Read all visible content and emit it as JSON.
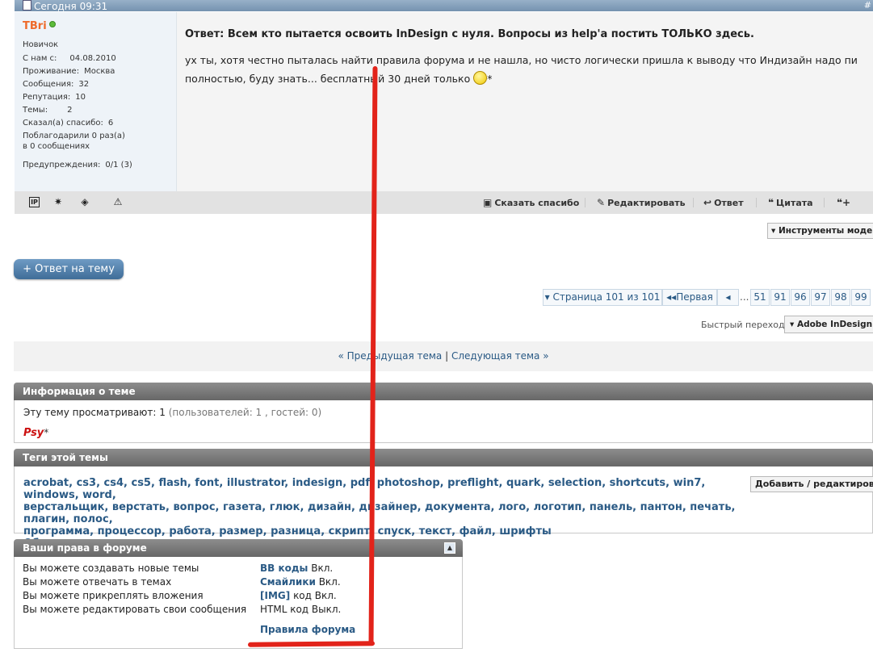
{
  "post": {
    "date": "Сегодня 09:31",
    "corner_mark": "#",
    "user": {
      "name": "TBri",
      "rank": "Новичок",
      "fields": [
        {
          "label": "С нам с:",
          "value": "04.08.2010"
        },
        {
          "label": "Проживание:",
          "value": "Москва"
        },
        {
          "label": "Сообщения:",
          "value": "32"
        },
        {
          "label": "Репутация:",
          "value": "10"
        },
        {
          "label": "Темы:",
          "value": "2"
        },
        {
          "label": "Сказал(а) спасибо:",
          "value": "6"
        }
      ],
      "thanked_line1": "Поблагодарили 0 раз(а)",
      "thanked_line2": "в 0 сообщениях",
      "warnings_label": "Предупреждения:",
      "warnings_value": "0/1 (3)"
    },
    "title": "Ответ: Всем кто пытается освоить InDesign с нуля. Вопросы из help'а постить ТОЛЬКО здесь.",
    "text_line1": "ух ты, хотя честно пыталась найти правила форума и не нашла, но чисто логически пришла к выводу что Индизайн надо пи",
    "text_line2": "полностью, буду знать... бесплатный 30 дней только",
    "text_suffix": "*",
    "actions": {
      "thanks": "Сказать спасибо",
      "edit": "Редактировать",
      "reply": "Ответ",
      "quote": "Цитата"
    }
  },
  "mod_tools": "Инструменты модер",
  "reply_button": "+ Ответ на тему",
  "pager": {
    "label": "Страница 101 из 101",
    "first": "Первая",
    "ellipsis": "...",
    "pages": [
      "51",
      "91",
      "96",
      "97",
      "98",
      "99"
    ]
  },
  "quick_nav": {
    "label": "Быстрый переход",
    "value": "Adobe InDesign"
  },
  "navlinks": {
    "prev": "« Предыдущая тема",
    "sep": "|",
    "next": "Следующая тема »"
  },
  "topic_info": {
    "title": "Информация о теме",
    "viewing_prefix": "Эту тему просматривают:",
    "viewing_count": "1",
    "viewing_detail": "(пользователей: 1 , гостей: 0)",
    "viewer": "Psy",
    "viewer_suffix": "*"
  },
  "tags": {
    "title": "Теги этой темы",
    "line1": "acrobat, cs3, cs4, cs5, flash, font, illustrator, indesign, pdf, photoshop, preflight, quark, selection, shortcuts, win7, windows, word,",
    "line2": "верстальщик, верстать, вопрос, газета, глюк, дизайн, дизайнер, документа, лого, логотип, панель, пантон, печать, плагин, полос,",
    "line3": "программа, процессор, работа, размер, разница, скрипт, спуск, текст, файл, шрифты",
    "cloud": "Облако тегов",
    "edit_button": "Добавить / редактироват"
  },
  "permissions": {
    "title": "Ваши права в форуме",
    "left": [
      "Вы можете создавать новые темы",
      "Вы можете отвечать в темах",
      "Вы можете прикреплять вложения",
      "Вы можете редактировать свои сообщения"
    ],
    "bbcode_label": "BB коды",
    "bbcode_state": "Вкл.",
    "smilies_label": "Смайлики",
    "smilies_state": "Вкл.",
    "img_label": "[IMG]",
    "img_state": "код Вкл.",
    "html_label": "HTML код",
    "html_state": "Выкл.",
    "rules": "Правила форума"
  },
  "colors": {
    "annotation": "#e2231a",
    "link": "#2a5a85",
    "username": "#ee6a2a",
    "viewer": "#cc1111"
  }
}
